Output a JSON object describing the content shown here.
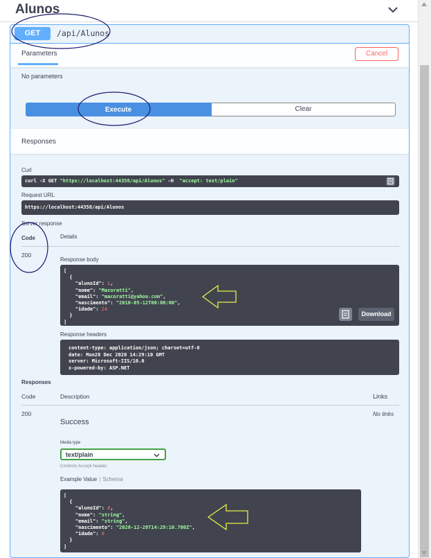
{
  "tag": {
    "title": "Alunos",
    "collapse_icon": "chevron-up-icon"
  },
  "operation": {
    "method": "GET",
    "path": "/api/Alunos"
  },
  "tabs": {
    "parameters_label": "Parameters",
    "cancel_label": "Cancel"
  },
  "parameters": {
    "empty_text": "No parameters"
  },
  "actions": {
    "execute_label": "Execute",
    "clear_label": "Clear"
  },
  "responses_section": {
    "title": "Responses"
  },
  "curl": {
    "label": "Curl",
    "parts": {
      "prefix": "curl -X GET ",
      "url": "\"https://localhost:44358/api/Alunos\"",
      "flag": " -H  ",
      "header": "\"accept: text/plain\""
    }
  },
  "request_url": {
    "label": "Request URL",
    "value": "https://localhost:44358/api/Alunos"
  },
  "server_response": {
    "label": "Server response",
    "code_header": "Code",
    "details_header": "Details",
    "code": "200",
    "body_label": "Response body",
    "body_lines": {
      "open_bracket": "[",
      "open_brace": "  {",
      "l1_key": "    \"alunoId\": ",
      "l1_val": "1",
      "l2_key": "    \"nome\": ",
      "l2_val": "\"Macoratti\"",
      "l3_key": "    \"email\": ",
      "l3_val": "\"macoratti@yahoo.com\"",
      "l4_key": "    \"nascimento\": ",
      "l4_val": "\"2010-05-12T00:00:00\"",
      "l5_key": "    \"idade\": ",
      "l5_val": "24",
      "close_brace": "  }",
      "close_bracket": "]"
    },
    "download_label": "Download",
    "headers_label": "Response headers",
    "headers": [
      "content-type: application/json; charset=utf-8",
      "date: Mon28 Dec 2020 14:29:10 GMT",
      "server: Microsoft-IIS/10.0",
      "x-powered-by: ASP.NET"
    ]
  },
  "responses_doc": {
    "label": "Responses",
    "code_header": "Code",
    "description_header": "Description",
    "links_header": "Links",
    "code": "200",
    "description": "Success",
    "no_links": "No links",
    "media_type_label": "Media type",
    "media_type_value": "text/plain",
    "controls_text": "Controls Accept header.",
    "example_value_tab": "Example Value",
    "schema_tab": "Schema",
    "example_lines": {
      "open_bracket": "[",
      "open_brace": "  {",
      "l1_key": "    \"alunoId\": ",
      "l1_val": "0",
      "l2_key": "    \"nome\": ",
      "l2_val": "\"string\"",
      "l3_key": "    \"email\": ",
      "l3_val": "\"string\"",
      "l4_key": "    \"nascimento\": ",
      "l4_val": "\"2020-12-28T14:29:10.700Z\"",
      "l5_key": "    \"idade\": ",
      "l5_val": "0",
      "close_brace": "  }",
      "close_bracket": "]"
    }
  },
  "colors": {
    "get_blue": "#61affe",
    "execute_blue": "#4990e2",
    "cancel_red": "#ff6060",
    "code_bg": "#41444e",
    "string_green": "#a2fca2",
    "number_red": "#d36363",
    "annotation_ellipse": "#1a1a6e",
    "annotation_arrow": "#e8ef4a"
  }
}
